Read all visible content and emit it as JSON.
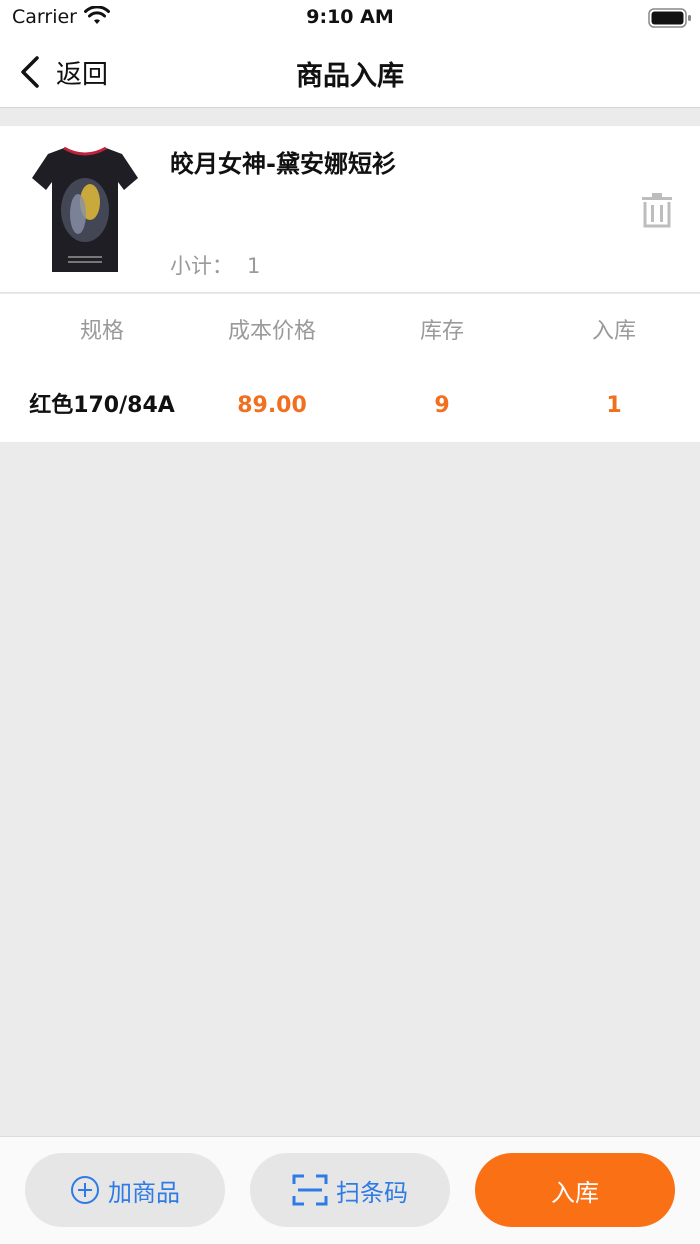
{
  "status_bar": {
    "carrier": "Carrier",
    "time": "9:10 AM"
  },
  "nav": {
    "back_label": "返回",
    "title": "商品入库"
  },
  "product": {
    "name": "皎月女神-黛安娜短衫",
    "subtotal_label": "小计：",
    "subtotal_value": "1",
    "image_icon": "tshirt-image"
  },
  "spec_table": {
    "headers": [
      "规格",
      "成本价格",
      "库存",
      "入库"
    ],
    "rows": [
      {
        "spec": "红色170/84A",
        "cost": "89.00",
        "stock": "9",
        "in_stock": "1"
      }
    ]
  },
  "bottom_bar": {
    "add_label": "加商品",
    "scan_label": "扫条码",
    "submit_label": "入库"
  },
  "colors": {
    "accent": "#f97015",
    "link": "#2f7be5",
    "muted": "#9a9a9a",
    "background": "#ebebeb"
  }
}
